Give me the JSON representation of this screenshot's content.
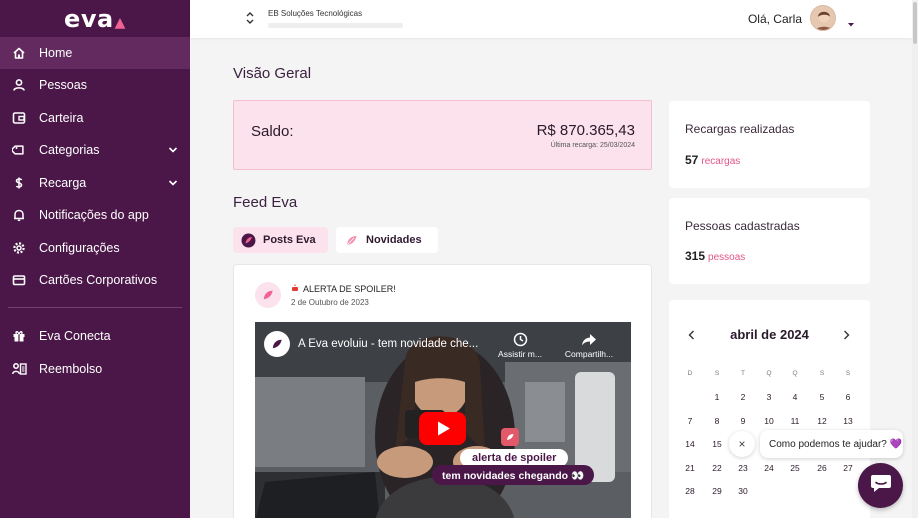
{
  "brand": {
    "logo": "eva",
    "accent": "#4a1748",
    "pink": "#f06292"
  },
  "sidebar": {
    "items": [
      {
        "label": "Home",
        "icon": "home-icon",
        "active": true
      },
      {
        "label": "Pessoas",
        "icon": "person-icon"
      },
      {
        "label": "Carteira",
        "icon": "wallet-icon"
      },
      {
        "label": "Categorias",
        "icon": "tag-icon",
        "expandable": true
      },
      {
        "label": "Recarga",
        "icon": "dollar-icon",
        "expandable": true
      },
      {
        "label": "Notificações do app",
        "icon": "bell-icon"
      },
      {
        "label": "Configurações",
        "icon": "gear-icon"
      },
      {
        "label": "Cartões Corporativos",
        "icon": "card-icon"
      }
    ],
    "items2": [
      {
        "label": "Eva Conecta",
        "icon": "gift-icon"
      },
      {
        "label": "Reembolso",
        "icon": "reimburse-icon"
      }
    ]
  },
  "topbar": {
    "company": "EB Soluções Tecnológicas",
    "greeting": "Olá, Carla"
  },
  "overview": {
    "title": "Visão Geral",
    "balance_label": "Saldo:",
    "balance_value": "R$ 870.365,43",
    "last_recharge": "Última recarga: 25/03/2024"
  },
  "stats": {
    "recharges_label": "Recargas realizadas",
    "recharges_count": "57",
    "recharges_unit": "recargas",
    "people_label": "Pessoas cadastradas",
    "people_count": "315",
    "people_unit": "pessoas"
  },
  "feed": {
    "title": "Feed Eva",
    "tabs": [
      "Posts Eva",
      "Novidades"
    ],
    "post": {
      "title": "ALERTA DE SPOILER!",
      "date": "2 de Outubro de 2023",
      "video_title": "A Eva evoluiu - tem novidade che...",
      "watch_later": "Assistir m...",
      "share": "Compartilh...",
      "overlay_1": "alerta de spoiler",
      "overlay_2": "tem novidades chegando 👀"
    }
  },
  "calendar": {
    "month": "abril de 2024",
    "weekdays": [
      "D",
      "S",
      "T",
      "Q",
      "Q",
      "S",
      "S"
    ],
    "first_weekday": 1,
    "days": 30
  },
  "chat": {
    "close": "×",
    "message": "Como podemos te ajudar? 💜"
  }
}
